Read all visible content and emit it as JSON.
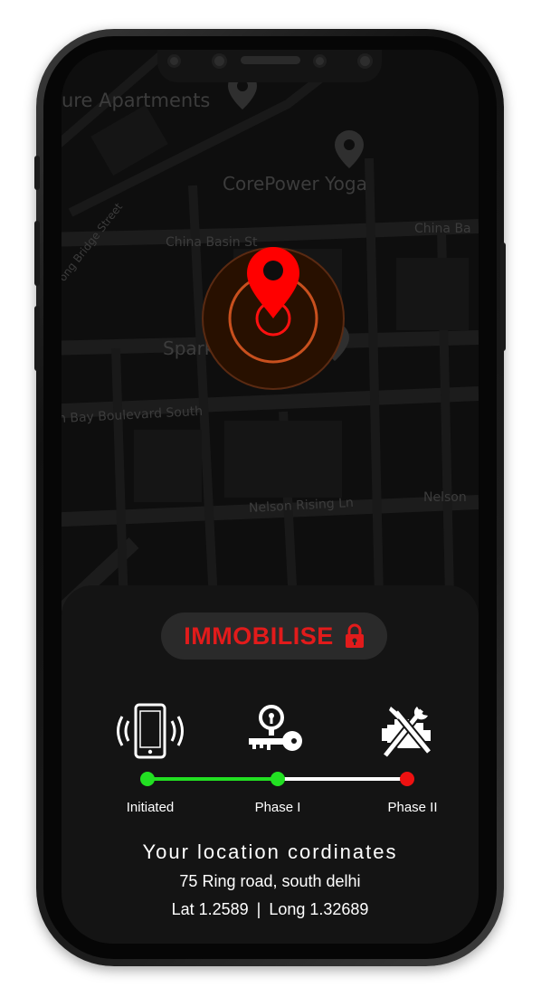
{
  "map": {
    "labels": [
      "ure Apartments",
      "CorePower Yoga",
      "China Basin St",
      "China Ba",
      "ong Bridge Street",
      "Spark Social SF",
      "n Bay Boulevard South",
      "Nelson Rising Ln",
      "Nelson"
    ],
    "pin_color": "#ff0000",
    "ring_color": "#c8501e"
  },
  "panel": {
    "immobilise_label": "IMMOBILISE",
    "accent_color": "#e21b1b"
  },
  "steps": [
    {
      "label": "Initiated",
      "icon": "phone-vibrating-icon",
      "status_color": "#22e022"
    },
    {
      "label": "Phase I",
      "icon": "key-lock-icon",
      "status_color": "#22e022"
    },
    {
      "label": "Phase II",
      "icon": "engine-repair-icon",
      "status_color": "#ee1111"
    }
  ],
  "location": {
    "title": "Your location cordinates",
    "address": "75 Ring road, south delhi",
    "lat": "Lat 1.2589",
    "separator": "|",
    "long": "Long 1.32689"
  }
}
